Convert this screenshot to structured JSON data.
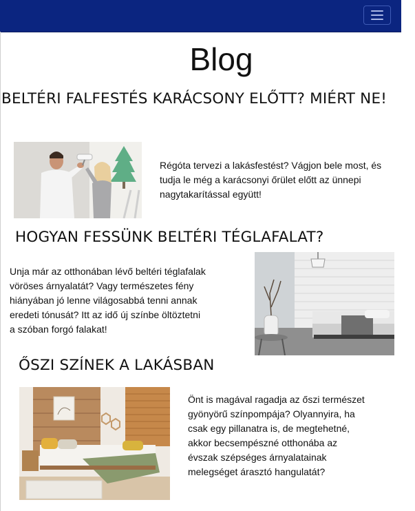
{
  "navbar": {
    "menu_icon": "hamburger-menu-icon",
    "background_color": "#0b2580"
  },
  "page": {
    "title": "Blog"
  },
  "posts": [
    {
      "title": "BELTÉRI FALFESTÉS KARÁCSONY ELŐTT? MIÉRT NE!",
      "excerpt_lines": [
        "Régóta tervezi a lakásfestést? Vágjon bele most, és",
        "tudja le még a karácsonyi őrület előtt az ünnepi",
        "nagytakarítással együtt!"
      ]
    },
    {
      "title": "HOGYAN FESSÜNK BELTÉRI TÉGLAFALAT?",
      "excerpt_lines": [
        "Unja már az otthonában lévő beltéri téglafalak",
        "vöröses árnyalatát? Vagy természetes fény",
        "hiányában jó lenne világosabbá tenni annak",
        "eredeti tónusát? Itt az idő új színbe öltöztetni",
        "a szóban forgó falakat!"
      ]
    },
    {
      "title": "ŐSZI SZÍNEK A LAKÁSBAN",
      "excerpt_lines": [
        "Önt is magával ragadja az őszi természet",
        "gyönyörű színpompája? Olyannyira, ha",
        "csak egy pillanatra is, de megtehetné,",
        "akkor becsempészné otthonába az",
        "évszak szépséges árnyalatainak",
        "melegséget árasztó hangulatát?"
      ]
    }
  ]
}
